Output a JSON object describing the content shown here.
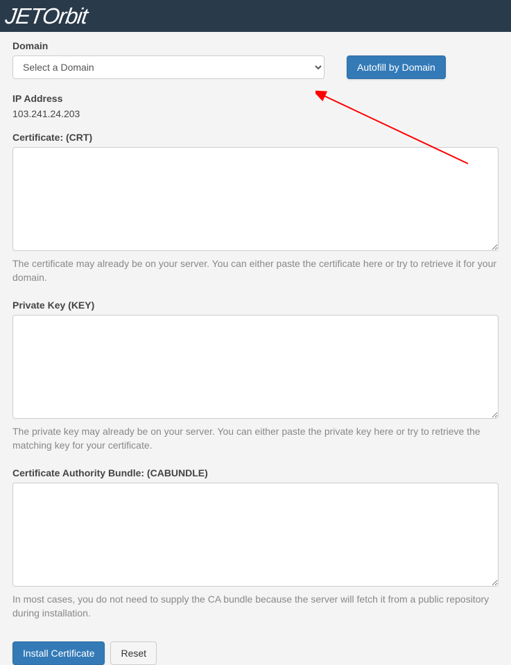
{
  "header": {
    "logo_text": "JETOrbit"
  },
  "form": {
    "domain_label": "Domain",
    "domain_placeholder": "Select a Domain",
    "autofill_button": "Autofill by Domain",
    "ip_label": "IP Address",
    "ip_value": "103.241.24.203",
    "crt_label": "Certificate: (CRT)",
    "crt_value": "",
    "crt_help": "The certificate may already be on your server. You can either paste the certificate here or try to retrieve it for your domain.",
    "key_label": "Private Key (KEY)",
    "key_value": "",
    "key_help": "The private key may already be on your server. You can either paste the private key here or try to retrieve the matching key for your certificate.",
    "cab_label": "Certificate Authority Bundle: (CABUNDLE)",
    "cab_value": "",
    "cab_help": "In most cases, you do not need to supply the CA bundle because the server will fetch it from a public repository during installation.",
    "install_button": "Install Certificate",
    "reset_button": "Reset"
  },
  "annotation": {
    "arrow_color": "#ff0000"
  }
}
